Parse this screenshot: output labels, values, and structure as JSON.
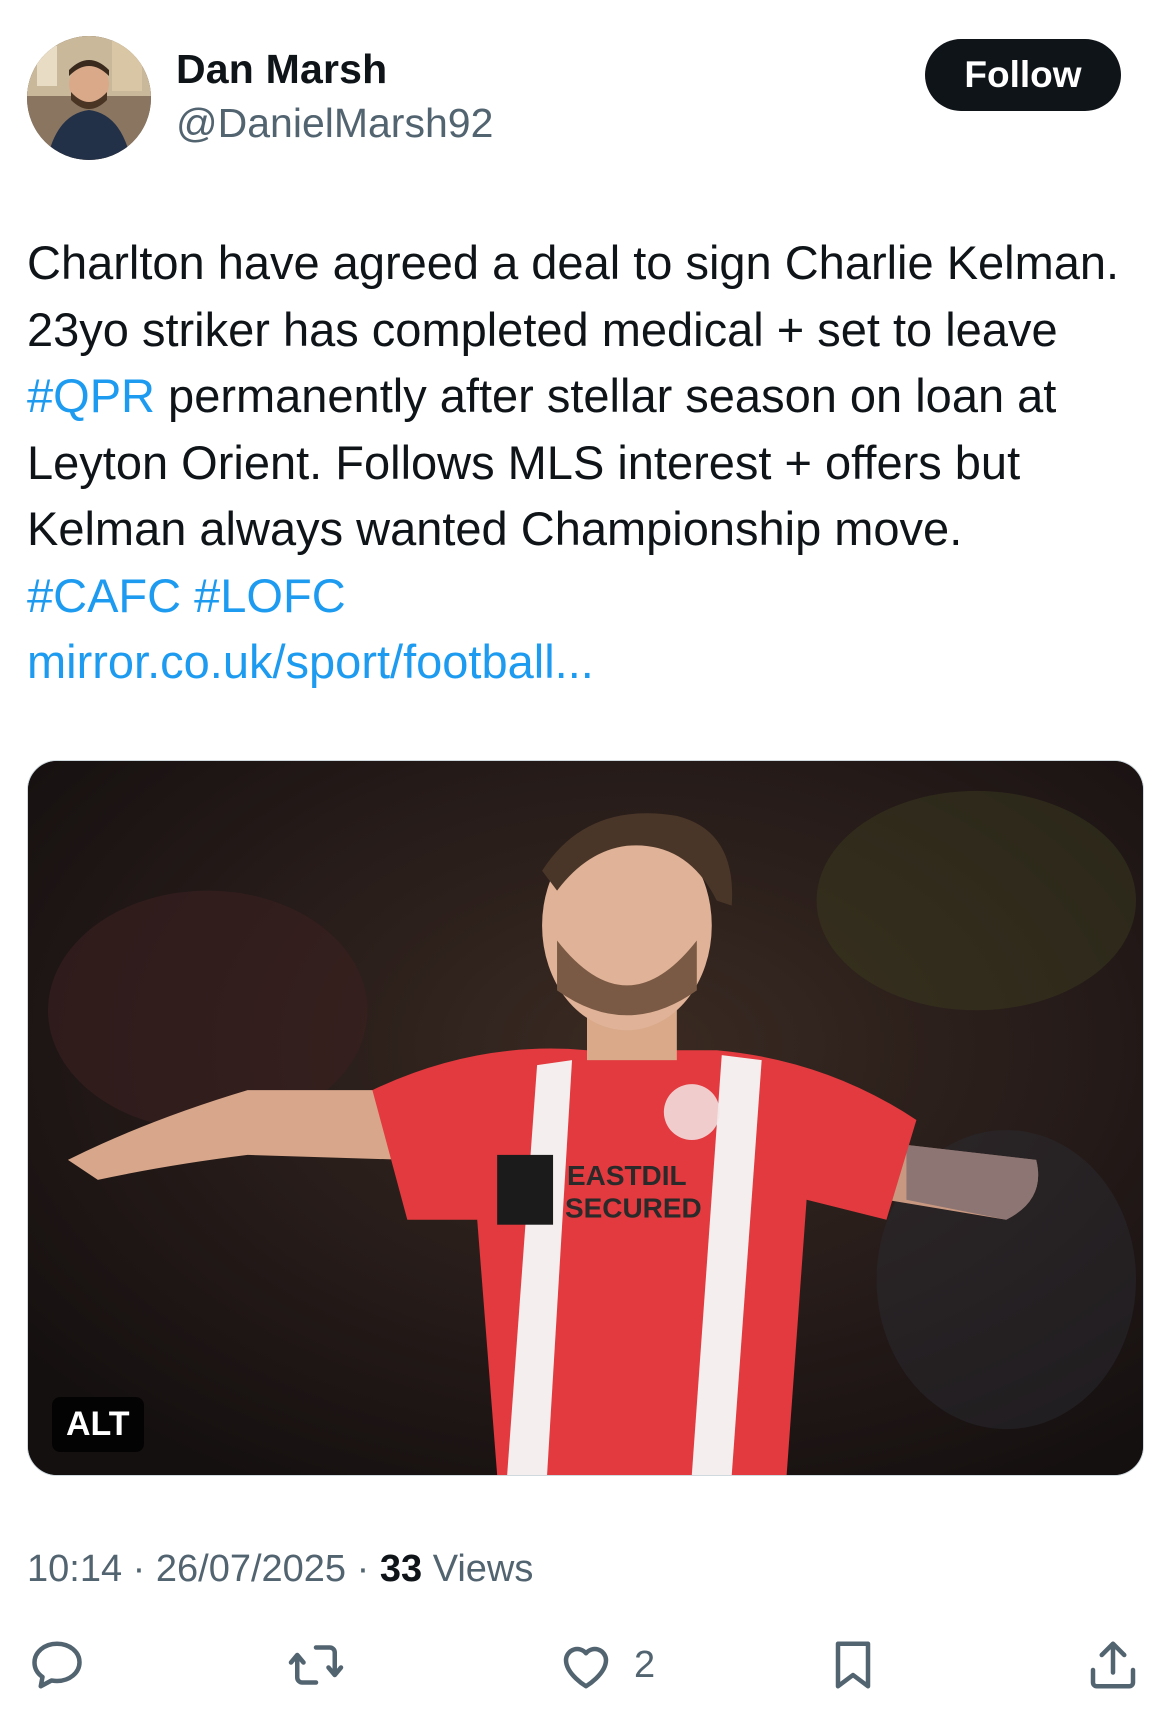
{
  "author": {
    "name": "Dan Marsh",
    "handle": "@DanielMarsh92"
  },
  "follow_button": {
    "label": "Follow"
  },
  "tweet": {
    "lines": [
      "Charlton have agreed a deal to sign Charlie Kelman.",
      "23yo striker has completed medical + set to leave"
    ],
    "hashtag_qpr": "#QPR",
    "line3_rest": " permanently after stellar season on loan at",
    "line4": "Leyton Orient. Follows MLS interest + offers but",
    "line5": "Kelman always wanted Championship move.",
    "hashtag_cafc": "#CAFC",
    "hashtag_lofc": "#LOFC",
    "url": "mirror.co.uk/sport/football..."
  },
  "media": {
    "alt_badge": "ALT",
    "shirt_sponsor_line1": "EASTDIL",
    "shirt_sponsor_line2": "SECURED"
  },
  "meta": {
    "time": "10:14",
    "separator": "·",
    "date": "26/07/2025",
    "views_count": "33",
    "views_label": "Views"
  },
  "actions": {
    "like_count": "2"
  },
  "colors": {
    "link": "#1d9bf0",
    "text": "#0f1419",
    "secondary": "#536471",
    "button_bg": "#0f1419"
  },
  "icons": [
    "reply-icon",
    "repost-icon",
    "like-icon",
    "bookmark-icon",
    "share-icon"
  ]
}
